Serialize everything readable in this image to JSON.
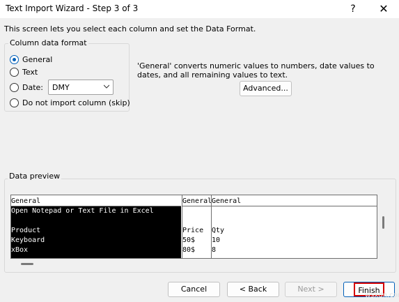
{
  "window": {
    "title": "Text Import Wizard - Step 3 of 3",
    "help_icon": "?",
    "close_icon": "✕"
  },
  "intro_text": "This screen lets you select each column and set the Data Format.",
  "format": {
    "legend": "Column data format",
    "options": [
      {
        "label": "General",
        "checked": true
      },
      {
        "label": "Text",
        "checked": false
      },
      {
        "label": "Date:",
        "checked": false
      },
      {
        "label": "Do not import column (skip)",
        "checked": false
      }
    ],
    "date_value": "DMY",
    "description": "'General' converts numeric values to numbers, date values to dates, and all remaining values to text.",
    "advanced_label": "Advanced..."
  },
  "preview": {
    "legend": "Data preview",
    "columns": [
      {
        "header": "General",
        "cells": [
          "Open Notepad or Text File in Excel",
          "",
          "Product",
          "Keyboard",
          "xBox"
        ]
      },
      {
        "header": "General",
        "cells": [
          "",
          "",
          "Price",
          "50$",
          "80$"
        ]
      },
      {
        "header": "General",
        "cells": [
          "",
          "",
          "Qty",
          "10",
          "8"
        ]
      }
    ]
  },
  "buttons": {
    "cancel": "Cancel",
    "back": "< Back",
    "next": "Next >",
    "finish": "Finish"
  },
  "watermark": "wsxdn.com",
  "colors": {
    "accent": "#005fb8",
    "highlight": "#d40000",
    "selected_column": "#000000"
  }
}
